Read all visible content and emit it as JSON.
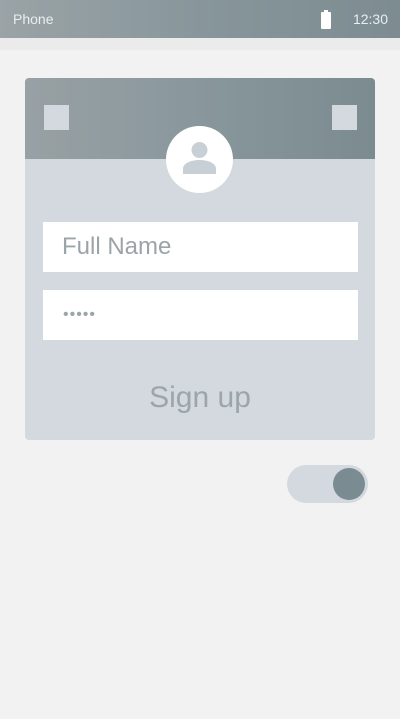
{
  "status_bar": {
    "title": "Phone",
    "time": "12:30",
    "battery_icon": "battery-icon"
  },
  "card": {
    "avatar_icon": "user-avatar-icon",
    "name_placeholder": "Full Name",
    "password_masked": "•••••",
    "signup_label": "Sign up"
  },
  "toggle": {
    "state": "on"
  },
  "colors": {
    "header_gradient_start": "#9aa3a6",
    "header_gradient_end": "#7c8c91",
    "card_background": "#d3d9de",
    "page_background": "#f2f2f2",
    "toggle_knob": "#7a8c91"
  }
}
